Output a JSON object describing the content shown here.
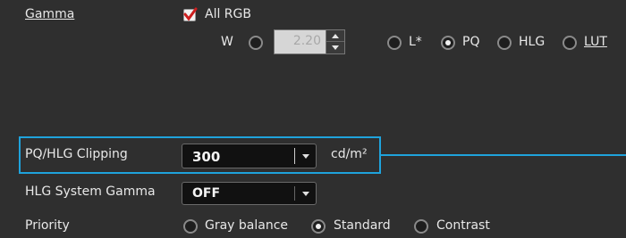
{
  "gamma": {
    "label": "Gamma",
    "all_rgb": {
      "label": "All RGB",
      "checked": true
    },
    "w_label": "W",
    "w_value": "2.20",
    "modes": [
      {
        "label": "L*",
        "checked": false
      },
      {
        "label": "PQ",
        "checked": true
      },
      {
        "label": "HLG",
        "checked": false
      },
      {
        "label": "LUT",
        "checked": false
      }
    ]
  },
  "pq_hlg_clipping": {
    "label": "PQ/HLG Clipping",
    "value": "300",
    "unit": "cd/m²"
  },
  "hlg_system_gamma": {
    "label": "HLG System Gamma",
    "value": "OFF"
  },
  "priority": {
    "label": "Priority",
    "options": [
      {
        "label": "Gray balance",
        "checked": false
      },
      {
        "label": "Standard",
        "checked": true
      },
      {
        "label": "Contrast",
        "checked": false
      }
    ]
  },
  "colors": {
    "background": "#2f2f2f",
    "highlight": "#1fa3dc",
    "checkbox_check": "#cc1e1e"
  }
}
